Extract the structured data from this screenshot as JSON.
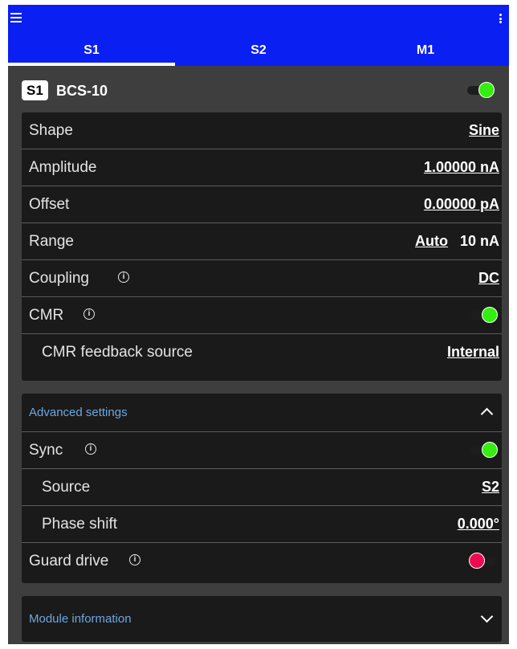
{
  "tabs": [
    "S1",
    "S2",
    "M1"
  ],
  "device": {
    "badge": "S1",
    "name": "BCS-10",
    "enabled": true
  },
  "main_settings": {
    "shape": {
      "label": "Shape",
      "value": "Sine"
    },
    "amplitude": {
      "label": "Amplitude",
      "value": "1.00000 nA"
    },
    "offset": {
      "label": "Offset",
      "value": "0.00000 pA"
    },
    "range": {
      "label": "Range",
      "mode": "Auto",
      "value": "10 nA"
    },
    "coupling": {
      "label": "Coupling",
      "value": "DC"
    },
    "cmr": {
      "label": "CMR",
      "enabled": true
    },
    "cmr_feedback": {
      "label": "CMR feedback source",
      "value": "Internal"
    }
  },
  "advanced": {
    "header": "Advanced settings",
    "sync": {
      "label": "Sync",
      "enabled": true
    },
    "source": {
      "label": "Source",
      "value": "S2"
    },
    "phase_shift": {
      "label": "Phase shift",
      "value": "0.000°"
    },
    "guard_drive": {
      "label": "Guard drive",
      "enabled": false
    }
  },
  "module_info": {
    "header": "Module information"
  },
  "info_glyph": "i",
  "colors": {
    "appbar": "#0a1ff2",
    "toggle_on": "#33ee10",
    "toggle_off": "#ee0a52",
    "section_header": "#6ea6e0"
  }
}
